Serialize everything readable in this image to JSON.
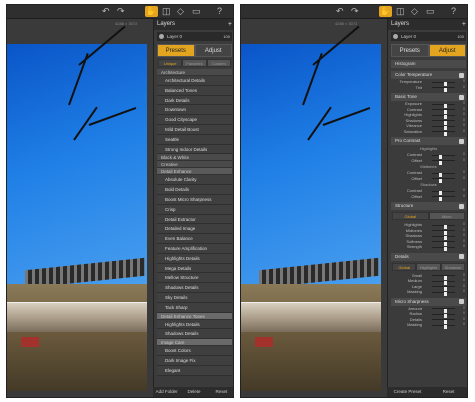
{
  "toolbar": {
    "pan": "✋",
    "help": "?"
  },
  "image_size": "4288 × 3072",
  "layers_panel": {
    "title": "Layers",
    "layer_name": "Layer 0",
    "layer_pct": "100"
  },
  "tabs": {
    "presets": "Presets",
    "adjust": "Adjust"
  },
  "preset_subtabs": [
    "Unique",
    "Favorites",
    "Custom"
  ],
  "preset_groups": [
    {
      "name": "Architecture",
      "items": [
        "Architectural Details",
        "Balanced Tones",
        "Dark Details",
        "Downtown",
        "Good Cityscape",
        "Mild Detail Boost",
        "Seattle",
        "Strong Indoor Details"
      ]
    },
    {
      "name": "Black & White",
      "items": []
    },
    {
      "name": "Creative",
      "items": []
    },
    {
      "name": "Detail Enhance",
      "items": [
        "Absolute Clarity",
        "Bold Details",
        "Boost Micro Sharpness",
        "Crisp",
        "Detail Extractor",
        "Detailed Image",
        "Even Balance",
        "Feature Amplification",
        "Highlights Details",
        "Mega Details",
        "Mellow Structure",
        "Shadows Details",
        "Sky Details",
        "Tack Sharp"
      ]
    },
    {
      "name": "Detail Enhance Tones",
      "items": [
        "Highlights Details",
        "Shadows Details"
      ]
    },
    {
      "name": "Image Care",
      "items": [
        "Boost Colors",
        "Dark Image Fix",
        "Elegant"
      ]
    }
  ],
  "left_bottom": [
    "Add Folder",
    "Delete",
    "Reset"
  ],
  "adjust": {
    "histogram": "Histogram",
    "color_temp": {
      "title": "Color Temperature",
      "rows": [
        {
          "label": "Temperature",
          "value": "0",
          "pos": 0.5
        },
        {
          "label": "Tint",
          "value": "0",
          "pos": 0.5
        }
      ]
    },
    "basic_tone": {
      "title": "Basic Tone",
      "rows": [
        {
          "label": "Exposure",
          "value": "0",
          "pos": 0.5
        },
        {
          "label": "Contrast",
          "value": "0",
          "pos": 0.5
        },
        {
          "label": "Highlights",
          "value": "0",
          "pos": 0.5
        },
        {
          "label": "Shadows",
          "value": "0",
          "pos": 0.5
        },
        {
          "label": "Vibrance",
          "value": "0",
          "pos": 0.5
        },
        {
          "label": "Saturation",
          "value": "0",
          "pos": 0.5
        }
      ]
    },
    "pro_contrast": {
      "title": "Pro Contrast",
      "groups": [
        {
          "name": "Highlights",
          "rows": [
            {
              "label": "Contrast",
              "value": "0",
              "pos": 0.3
            },
            {
              "label": "Offset",
              "value": "0",
              "pos": 0.3
            }
          ]
        },
        {
          "name": "Midtones",
          "rows": [
            {
              "label": "Contrast",
              "value": "0",
              "pos": 0.3
            },
            {
              "label": "Offset",
              "value": "0",
              "pos": 0.3
            }
          ]
        },
        {
          "name": "Shadows",
          "rows": [
            {
              "label": "Contrast",
              "value": "0",
              "pos": 0.3
            },
            {
              "label": "Offset",
              "value": "0",
              "pos": 0.3
            }
          ]
        }
      ]
    },
    "structure": {
      "title": "Structure",
      "tabs": [
        "Global",
        "Micro"
      ],
      "rows": [
        {
          "label": "Highlights",
          "value": "0",
          "pos": 0.5
        },
        {
          "label": "Midtones",
          "value": "0",
          "pos": 0.5
        },
        {
          "label": "Shadows",
          "value": "0",
          "pos": 0.5
        },
        {
          "label": "Softness",
          "value": "0",
          "pos": 0.5
        },
        {
          "label": "Strength",
          "value": "0",
          "pos": 0.5
        }
      ]
    },
    "details": {
      "title": "Details",
      "tabs": [
        "Global",
        "Highlights",
        "Shadows"
      ],
      "rows": [
        {
          "label": "Small",
          "value": "0",
          "pos": 0.5
        },
        {
          "label": "Medium",
          "value": "0",
          "pos": 0.5
        },
        {
          "label": "Large",
          "value": "0",
          "pos": 0.5
        },
        {
          "label": "Masking",
          "value": "0",
          "pos": 0.5
        }
      ]
    },
    "micro": {
      "title": "Micro Sharpness",
      "rows": [
        {
          "label": "Amount",
          "value": "0",
          "pos": 0.5
        },
        {
          "label": "Radius",
          "value": "0",
          "pos": 0.5
        },
        {
          "label": "Details",
          "value": "0",
          "pos": 0.5
        },
        {
          "label": "Masking",
          "value": "0",
          "pos": 0.5
        }
      ]
    },
    "bottom": [
      "Create Preset",
      "Reset"
    ]
  },
  "colors": {
    "accent": "#e3a51f",
    "panel": "#3b3b3b",
    "sky": "#1f7fe6"
  }
}
